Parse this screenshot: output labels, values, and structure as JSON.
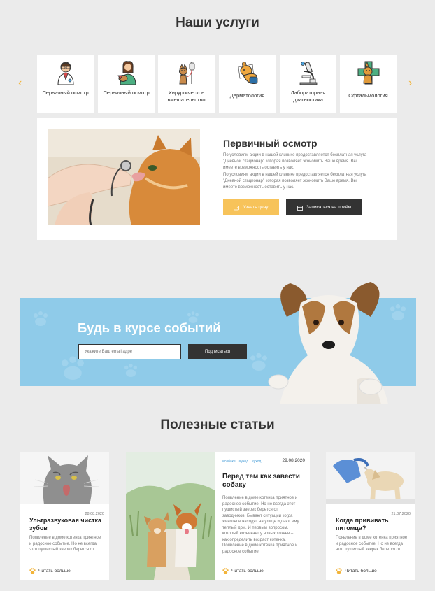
{
  "services_section": {
    "title": "Наши услуги",
    "prev_icon": "chevron-left-icon",
    "next_icon": "chevron-right-icon",
    "items": [
      {
        "label": "Первичный осмотр",
        "icon": "doctor-icon"
      },
      {
        "label": "Первичный осмотр",
        "icon": "vet-with-dog-icon"
      },
      {
        "label": "Хирургическое вмешательство",
        "icon": "dog-iv-drip-icon"
      },
      {
        "label": "Дерматология",
        "icon": "dog-cone-icon"
      },
      {
        "label": "Лабораторная диагностика",
        "icon": "microscope-icon"
      },
      {
        "label": "Офтальмология",
        "icon": "eye-clinic-icon"
      }
    ]
  },
  "service_detail": {
    "title": "Первичный осмотр",
    "paragraphs": [
      "По условиям акции в нашей клинике предоставляется бесплатная услуга \"Дневной стационар\" которая позволяет экономить Ваше время. Вы имеете возможность оставить у нас.",
      "По условиям акции в нашей клинике предоставляется бесплатная услуга \"Дневной стационар\" которая позволяет экономить Ваше время. Вы имеете возможность оставить у нас."
    ],
    "price_button": "Узнать цену",
    "book_button": "Записаться на приём"
  },
  "newsletter": {
    "title": "Будь в курсе событий",
    "email_placeholder": "Укажите Ваш email адре",
    "subscribe_button": "Подписаться"
  },
  "articles_section": {
    "title": "Полезные статьи",
    "read_more": "Читать больше",
    "articles": [
      {
        "date": "28.08.2020",
        "title": "Ультразвуковая чистка зубов",
        "text": "Появление в доме котенка приятное и радосное событие. Но не всегда этот пушистый зверек берется от ..."
      },
      {
        "date": "29.08.2020",
        "tags": [
          "#собаке",
          "#уход",
          "#уход"
        ],
        "title": "Перед тем как завести собаку",
        "text": "Появление в доме котенка приятное и радосное событие. Но не всегда этот пушистый зверек берется от заводчиков. Бывают ситуации когда животное находят на улице и дают ему теплый дом. И первым вопросом, который возникает у новых хозяев – как определить возраст котенка. Появление в доме котенка приятное и радосное событие."
      },
      {
        "date": "21.07.2020",
        "title": "Когда прививать питомца?",
        "text": "Появление в доме котенка приятное и радосное событие. Но не всегда этот пушистый зверек берется от ..."
      }
    ]
  },
  "colors": {
    "accent": "#f7c35a",
    "dark": "#333333",
    "banner": "#8fcbe9",
    "background": "#ebebeb"
  }
}
